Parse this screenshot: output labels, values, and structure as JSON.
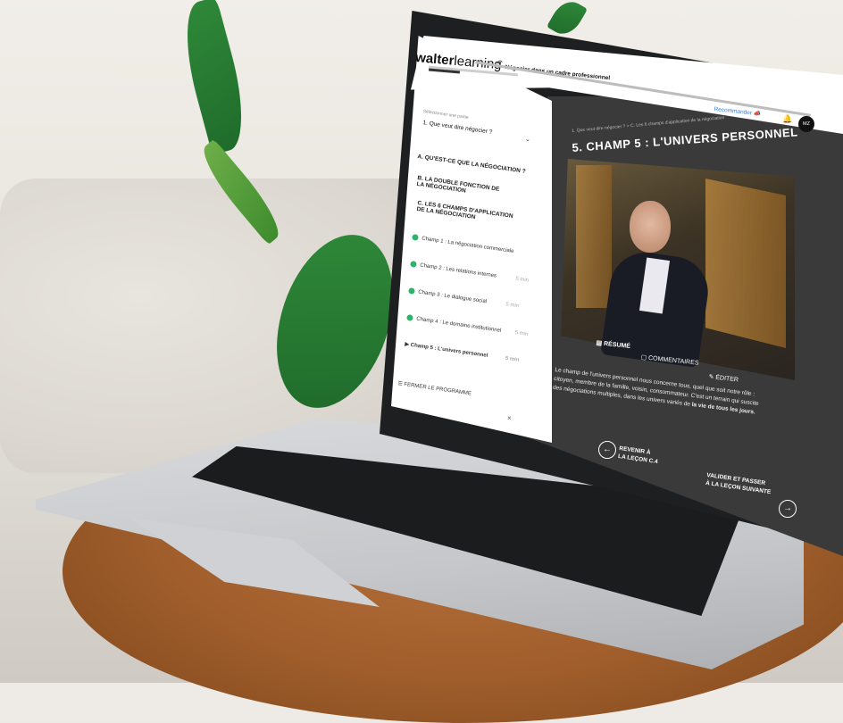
{
  "app": {
    "logo_bold": "walter",
    "logo_light": "learning",
    "course_title": "Négocier dans un cadre professionnel",
    "recommend_label": "Recommander",
    "avatar_initials": "MZ"
  },
  "sidebar": {
    "section_label": "Sélectionner une partie",
    "selected_part": "1. Que veut dire négocier ?",
    "sections": [
      "A. QU'EST-CE QUE LA NÉGOCIATION ?",
      "B. LA DOUBLE FONCTION DE LA NÉGOCIATION",
      "C. LES 6 CHAMPS D'APPLICATION DE LA NÉGOCIATION"
    ],
    "lessons": [
      {
        "label": "Champ 1 : La négociation commerciale",
        "duration": ""
      },
      {
        "label": "Champ 2 : Les relations internes",
        "duration": "5 min"
      },
      {
        "label": "Champ 3 : Le dialogue social",
        "duration": "5 min"
      },
      {
        "label": "Champ 4 : Le domaine institutionnel",
        "duration": "5 min"
      },
      {
        "label": "Champ 5 : L'univers personnel",
        "duration": "5 min"
      }
    ],
    "close_program": "FERMER LE PROGRAMME"
  },
  "content": {
    "breadcrumb": "1. Que veut dire négocier ? > C. Les 6 champs d'application de la négociation",
    "title": "5. CHAMP 5 : L'UNIVERS PERSONNEL",
    "tabs": [
      "RÉSUMÉ",
      "COMMENTAIRES",
      "ÉDITER"
    ],
    "summary_text_1": "Le champ de l'univers personnel nous concerne tous, quel que soit notre rôle :",
    "summary_text_2": "citoyen, membre de la famille, voisin, consommateur. C'est un terrain qui suscite",
    "summary_text_3": "des négociations multiples, dans les univers variés de",
    "summary_text_bold": "la vie de tous les jours.",
    "prev_button_line1": "REVENIR À",
    "prev_button_line2": "LA LEÇON C.4",
    "next_button_line1": "VALIDER ET PASSER",
    "next_button_line2": "À LA LEÇON SUIVANTE"
  },
  "colors": {
    "accent_green": "#2fb36b",
    "content_bg": "#3a3a3a",
    "sidebar_bg": "#ffffff"
  }
}
